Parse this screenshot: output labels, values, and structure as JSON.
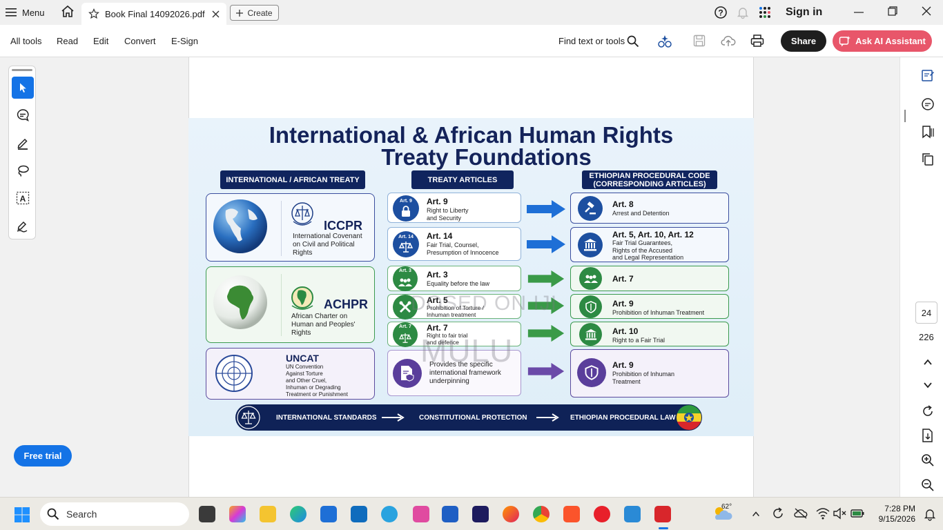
{
  "titlebar": {
    "menu_label": "Menu",
    "tab_title": "Book Final 14092026.pdf",
    "create_label": "Create",
    "sign_in": "Sign in"
  },
  "toolbar": {
    "items": [
      "All tools",
      "Read",
      "Edit",
      "Convert",
      "E-Sign"
    ],
    "find_text": "Find text or tools",
    "share_label": "Share",
    "ai_label": "Ask AI Assistant"
  },
  "sidebar": {
    "free_trial": "Free trial"
  },
  "page_nav": {
    "current": "24",
    "total": "226"
  },
  "infographic": {
    "title_line1": "International & African Human Rights",
    "title_line2": "Treaty Foundations",
    "headers": {
      "treaty": "INTERNATIONAL / AFRICAN TREATY",
      "articles": "TREATY ARTICLES",
      "ethiopian_line1": "ETHIOPIAN PROCEDURAL CODE",
      "ethiopian_line2": "(CORRESPONDING ARTICLES)"
    },
    "treaties": [
      {
        "acronym": "ICCPR",
        "full": [
          "International Covenant",
          "on Civil and Political",
          "Rights"
        ]
      },
      {
        "acronym": "ACHPR",
        "full": [
          "African Charter on",
          "Human and Peoples'",
          "Rights"
        ]
      },
      {
        "acronym": "UNCAT",
        "full": [
          "UN Convention",
          "Against Torture",
          "and Other Cruel,",
          "Inhuman or Degrading",
          "Treatment or Punishment"
        ]
      }
    ],
    "treaty_articles": [
      {
        "tag": "Art. 9",
        "title": "Art. 9",
        "sub": [
          "Right to Liberty",
          "and Security"
        ]
      },
      {
        "tag": "Art. 14",
        "title": "Art. 14",
        "sub": [
          "Fair Trial, Counsel,",
          "Presumption of Innocence"
        ]
      },
      {
        "tag": "Art. 3",
        "title": "Art. 3",
        "sub": [
          "Equality before the law"
        ]
      },
      {
        "tag": "",
        "title": "Art. 5",
        "sub": [
          "Prohibition of Torture /",
          "Inhuman treatment"
        ]
      },
      {
        "tag": "Art. 7",
        "title": "Art. 7",
        "sub": [
          "Right to fair trial",
          "and defence"
        ]
      },
      {
        "tag": "",
        "title": "",
        "sub": [
          "Provides the specific",
          "international framework",
          "underpinning"
        ]
      }
    ],
    "ethiopian_articles": [
      {
        "title": "Art. 8",
        "sub": [
          "Arrest and Detention"
        ]
      },
      {
        "title": "Art. 5, Art. 10, Art. 12",
        "sub": [
          "Fair Trial Guarantees,",
          "Rights of the Accused",
          "and Legal Representation"
        ]
      },
      {
        "title": "Art. 7",
        "sub": []
      },
      {
        "title": "Art. 9",
        "sub": [
          "Prohibition of Inhuman Treatment"
        ]
      },
      {
        "title": "Art. 10",
        "sub": [
          "Right to a Fair Trial"
        ]
      },
      {
        "title": "Art. 9",
        "sub": [
          "Prohibition of Inhuman",
          "Treatment"
        ]
      }
    ],
    "flow": [
      "INTERNATIONAL STANDARDS",
      "CONSTITUTIONAL PROTECTION",
      "ETHIOPIAN PROCEDURAL LAW"
    ],
    "watermark_line1": "DOSED ON IJI",
    "watermark_line2": "MULU"
  },
  "taskbar": {
    "search_label": "Search",
    "weather": "62°",
    "time": "7:28 PM",
    "date": "9/15/2026"
  },
  "colors": {
    "accent_blue": "#1473e6",
    "navy": "#10245e",
    "green": "#2d8a43",
    "purple": "#5a3e9b",
    "ai_pink": "#e8566a"
  }
}
